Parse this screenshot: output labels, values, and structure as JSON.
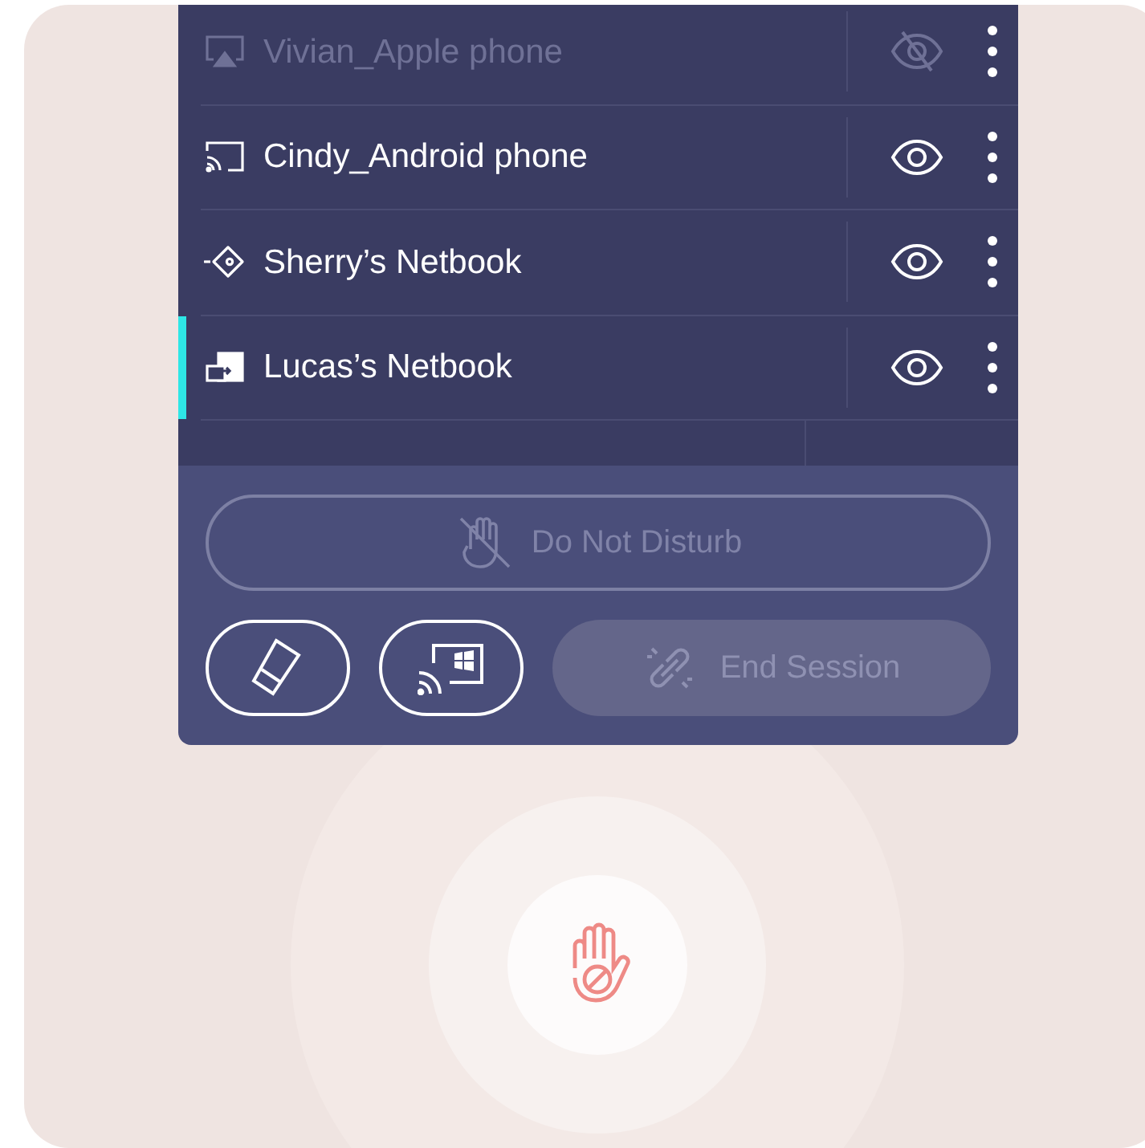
{
  "devices": [
    {
      "name": "Vivian_Apple phone",
      "kind": "airplay",
      "visible": false,
      "disabled": true,
      "selected": false
    },
    {
      "name": "Cindy_Android phone",
      "kind": "cast",
      "visible": true,
      "disabled": false,
      "selected": false
    },
    {
      "name": "Sherry’s Netbook",
      "kind": "tag",
      "visible": true,
      "disabled": false,
      "selected": false
    },
    {
      "name": "Lucas’s Netbook",
      "kind": "share",
      "visible": true,
      "disabled": false,
      "selected": true
    }
  ],
  "do_not_disturb": {
    "label": "Do Not Disturb",
    "disabled": true
  },
  "end_session": {
    "label": "End Session",
    "disabled": true
  }
}
